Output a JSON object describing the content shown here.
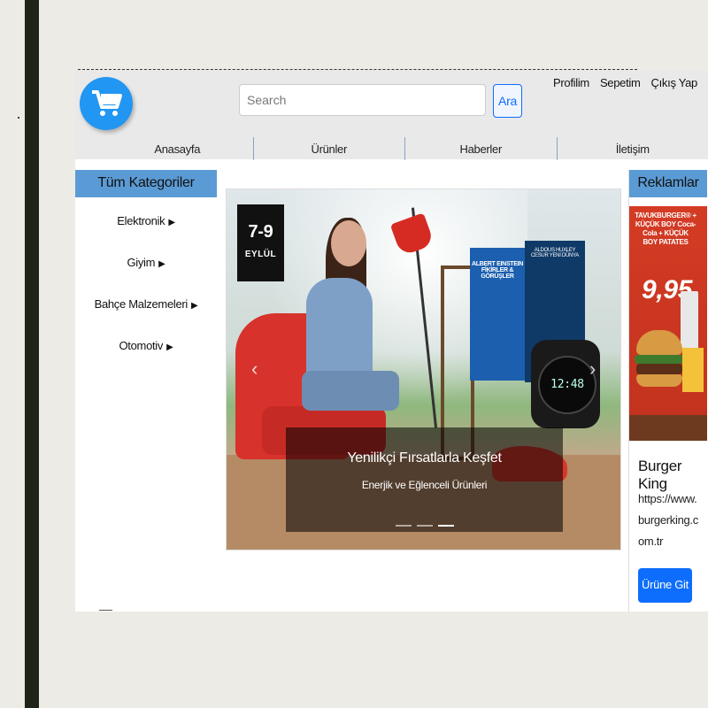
{
  "search": {
    "placeholder": "Search",
    "button_label": "Ara"
  },
  "top_links": [
    "Profilim",
    "Sepetim",
    "Çıkış Yap"
  ],
  "nav": [
    "Anasayfa",
    "Ürünler",
    "Haberler",
    "İletişim"
  ],
  "categories": {
    "header": "Tüm Kategoriler",
    "items": [
      "Elektronik",
      "Giyim",
      "Bahçe Malzemeleri",
      "Otomotiv"
    ]
  },
  "carousel": {
    "badge_number": "7-9",
    "badge_month": "EYLÜL",
    "book1_title": "ALBERT EINSTEIN\nFİKİRLER & GÖRÜŞLER",
    "book2_title": "ALDOUS HUXLEY\nCESUR YENİ DÜNYA",
    "watch_display": "12:48",
    "caption_title": "Yenilikçi Fırsatlarla Keşfet",
    "caption_subtitle": "Enerjik ve Eğlenceli Ürünleri",
    "slide_count": 3,
    "active_slide": 3
  },
  "ads": {
    "header": "Reklamlar",
    "image_brand": "TAVUKBURGER® + KÜÇÜK BOY Coca-Cola + KÜÇÜK BOY PATATES",
    "image_price": "9,95",
    "title": "Burger King",
    "url": "https://www.burgerking.com.tr",
    "button_label": "Ürüne Git"
  },
  "colors": {
    "accent": "#2196f3",
    "section_header_bg": "#5b9bd5",
    "primary_button": "#0d6efd"
  }
}
